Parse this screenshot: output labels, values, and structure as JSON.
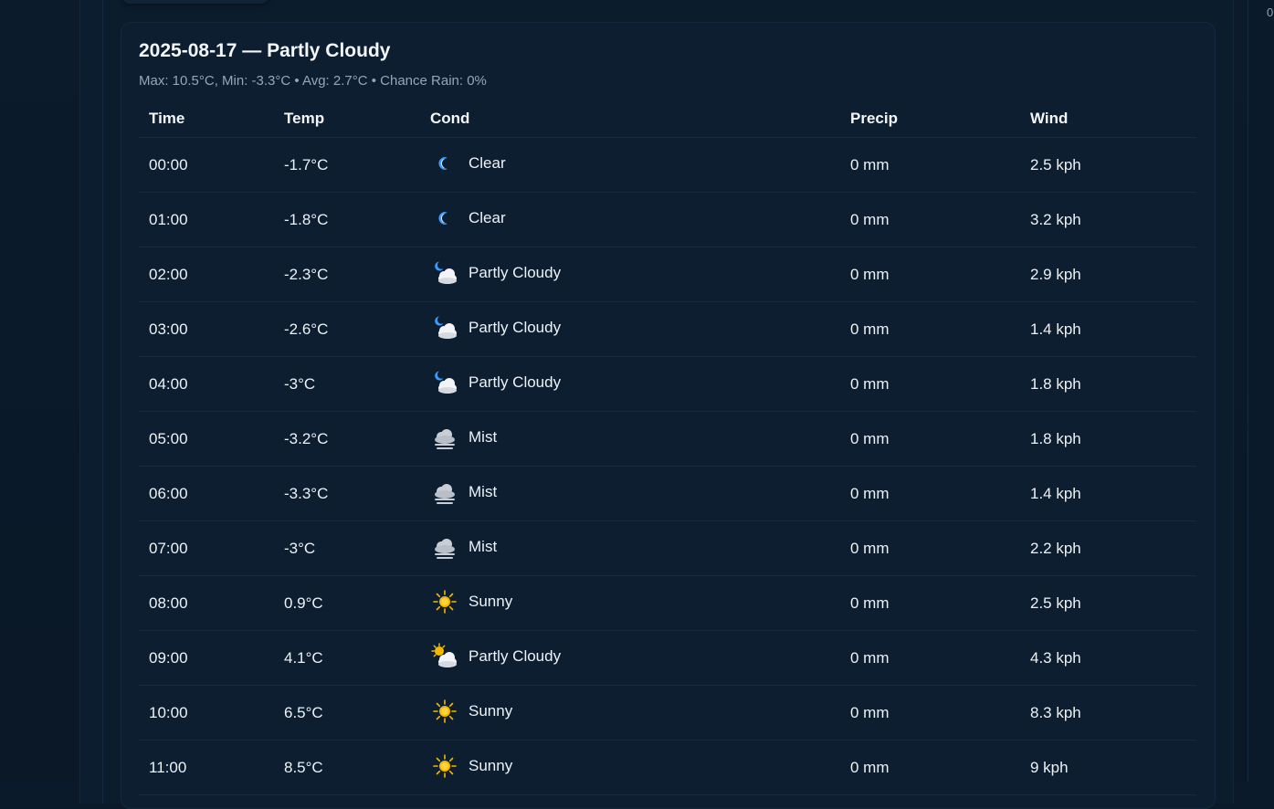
{
  "day": {
    "date": "2025-08-17",
    "title": "2025-08-17 — Partly Cloudy",
    "summary": "Max: 10.5°C, Min: -3.3°C • Avg: 2.7°C • Chance Rain: 0%"
  },
  "right_strip_text": "0",
  "table": {
    "headers": {
      "time": "Time",
      "temp": "Temp",
      "cond": "Cond",
      "precip": "Precip",
      "wind": "Wind"
    },
    "rows": [
      {
        "time": "00:00",
        "temp": "-1.7°C",
        "icon": "moon-icon",
        "cond": "Clear",
        "precip": "0 mm",
        "wind": "2.5 kph"
      },
      {
        "time": "01:00",
        "temp": "-1.8°C",
        "icon": "moon-icon",
        "cond": "Clear",
        "precip": "0 mm",
        "wind": "3.2 kph"
      },
      {
        "time": "02:00",
        "temp": "-2.3°C",
        "icon": "partly-cloudy-night-icon",
        "cond": "Partly Cloudy",
        "precip": "0 mm",
        "wind": "2.9 kph"
      },
      {
        "time": "03:00",
        "temp": "-2.6°C",
        "icon": "partly-cloudy-night-icon",
        "cond": "Partly Cloudy",
        "precip": "0 mm",
        "wind": "1.4 kph"
      },
      {
        "time": "04:00",
        "temp": "-3°C",
        "icon": "partly-cloudy-night-icon",
        "cond": "Partly Cloudy",
        "precip": "0 mm",
        "wind": "1.8 kph"
      },
      {
        "time": "05:00",
        "temp": "-3.2°C",
        "icon": "mist-icon",
        "cond": "Mist",
        "precip": "0 mm",
        "wind": "1.8 kph"
      },
      {
        "time": "06:00",
        "temp": "-3.3°C",
        "icon": "mist-icon",
        "cond": "Mist",
        "precip": "0 mm",
        "wind": "1.4 kph"
      },
      {
        "time": "07:00",
        "temp": "-3°C",
        "icon": "mist-icon",
        "cond": "Mist",
        "precip": "0 mm",
        "wind": "2.2 kph"
      },
      {
        "time": "08:00",
        "temp": "0.9°C",
        "icon": "sun-icon",
        "cond": "Sunny",
        "precip": "0 mm",
        "wind": "2.5 kph"
      },
      {
        "time": "09:00",
        "temp": "4.1°C",
        "icon": "partly-cloudy-day-icon",
        "cond": "Partly Cloudy",
        "precip": "0 mm",
        "wind": "4.3 kph"
      },
      {
        "time": "10:00",
        "temp": "6.5°C",
        "icon": "sun-icon",
        "cond": "Sunny",
        "precip": "0 mm",
        "wind": "8.3 kph"
      },
      {
        "time": "11:00",
        "temp": "8.5°C",
        "icon": "sun-icon",
        "cond": "Sunny",
        "precip": "0 mm",
        "wind": "9 kph"
      }
    ]
  },
  "colors": {
    "background": "#0b1a2b",
    "card": "#0c1e30",
    "text": "#eef2f7",
    "muted": "#93a6bb",
    "sun": "#f5b800",
    "moon": "#3b9cff",
    "cloud": "#f2f4f7",
    "mist_cloud": "#c9ced6"
  }
}
